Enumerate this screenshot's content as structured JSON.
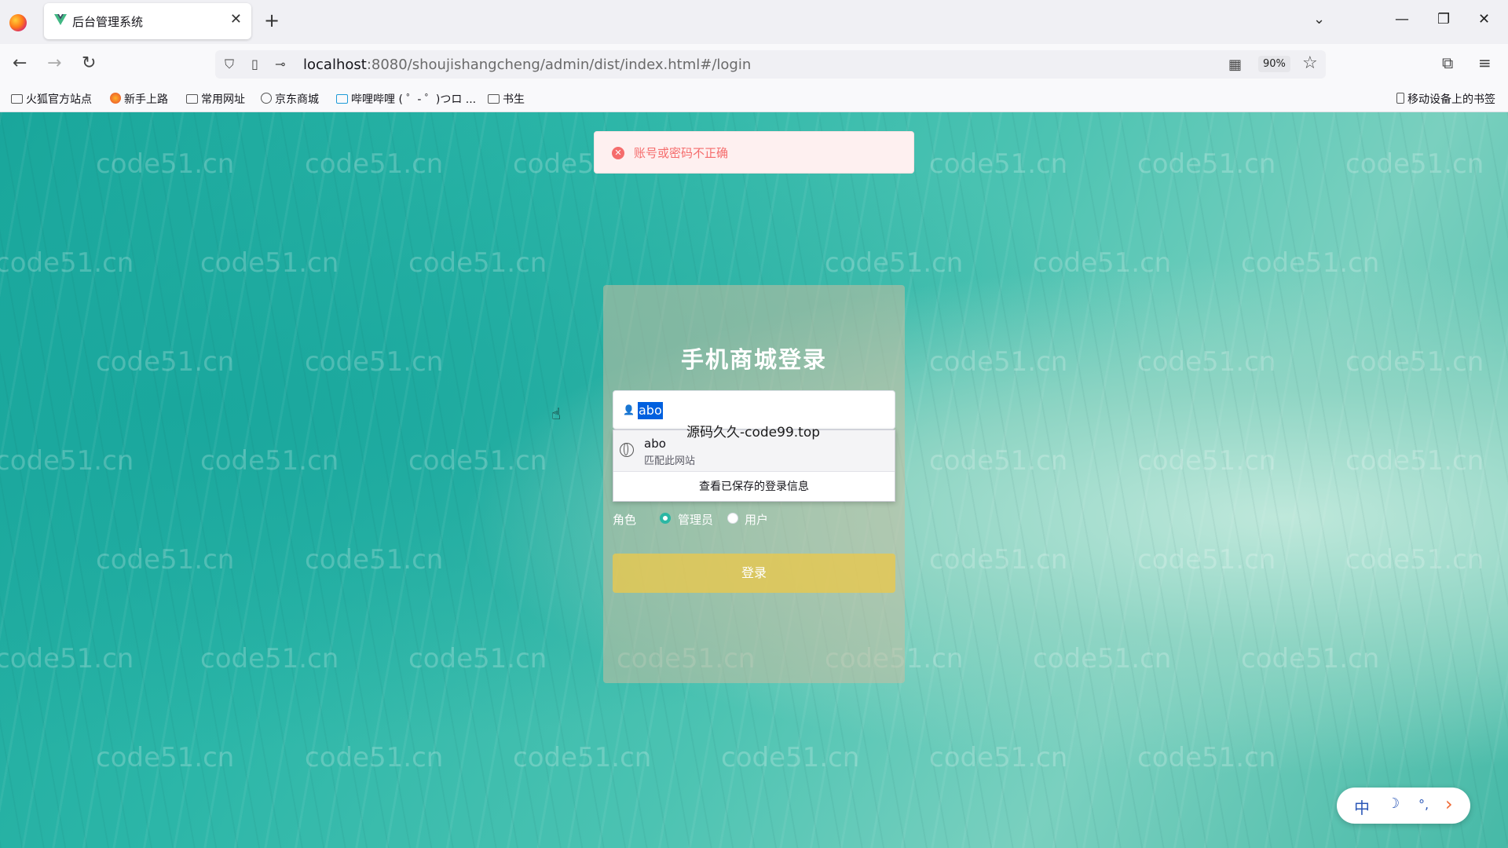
{
  "browser": {
    "tab_title": "后台管理系统",
    "tab_close": "✕",
    "new_tab": "+",
    "url_host": "localhost",
    "url_rest": ":8080/shoujishangcheng/admin/dist/index.html#/login",
    "zoom": "90%",
    "bookmarks": [
      "火狐官方站点",
      "新手上路",
      "常用网址",
      "京东商城",
      "哔哩哔哩 ( ゜- ゜)つロ ...",
      "书生"
    ],
    "mobile_bookmarks": "移动设备上的书签"
  },
  "toast": {
    "message": "账号或密码不正确"
  },
  "login": {
    "title": "手机商城登录",
    "username_value": "abo",
    "autofill": {
      "username": "abo",
      "subtitle": "匹配此网站",
      "footer": "查看已保存的登录信息"
    },
    "role_label": "角色",
    "roles": [
      {
        "label": "管理员",
        "selected": true
      },
      {
        "label": "用户",
        "selected": false
      }
    ],
    "submit_label": "登录"
  },
  "overlay_text": "源码久久-code99.top",
  "watermark": "code51.cn",
  "ime": {
    "lang": "中",
    "moon": "☽",
    "dots": "°,",
    "arrow": "›"
  },
  "colors": {
    "accent": "#2bb7a4",
    "toast_text": "#f56c6c",
    "button": "#e6c850"
  }
}
